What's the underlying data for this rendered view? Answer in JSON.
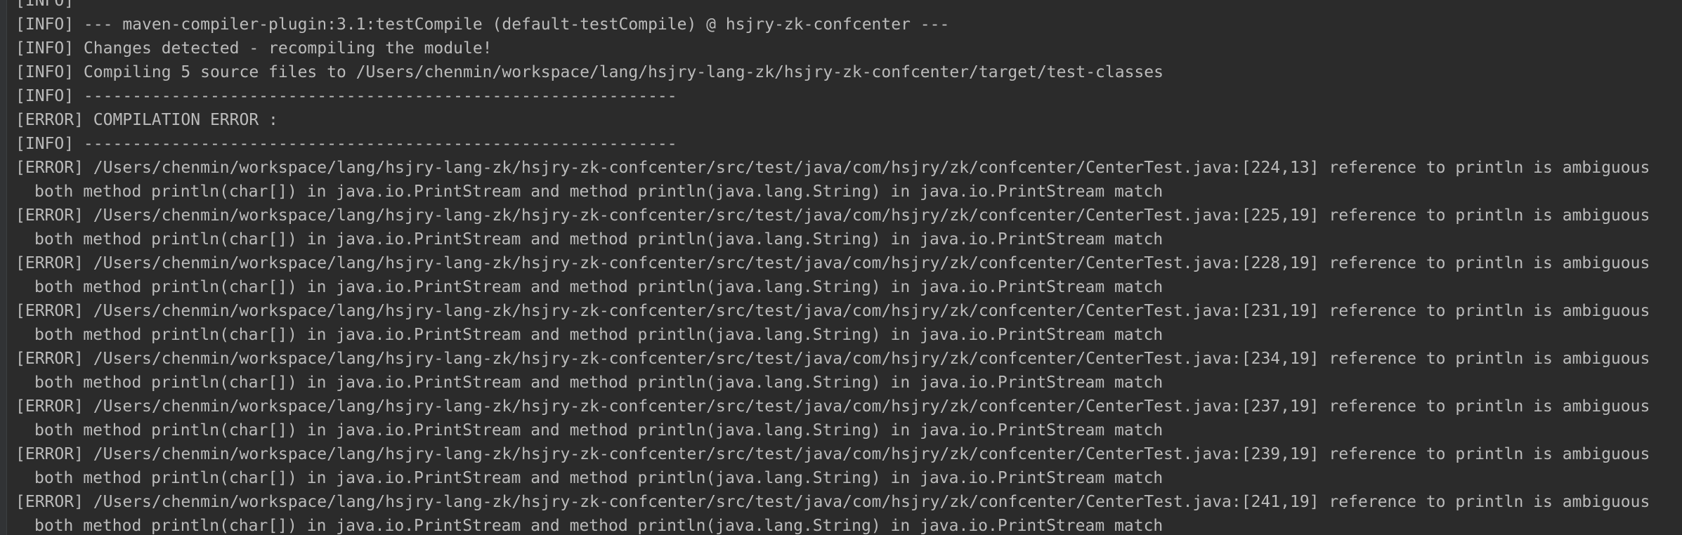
{
  "console": {
    "lines": [
      {
        "text": "[INFO]",
        "cont": false
      },
      {
        "text": "[INFO] --- maven-compiler-plugin:3.1:testCompile (default-testCompile) @ hsjry-zk-confcenter ---",
        "cont": false
      },
      {
        "text": "[INFO] Changes detected - recompiling the module!",
        "cont": false
      },
      {
        "text": "[INFO] Compiling 5 source files to /Users/chenmin/workspace/lang/hsjry-lang-zk/hsjry-zk-confcenter/target/test-classes",
        "cont": false
      },
      {
        "text": "[INFO] -------------------------------------------------------------",
        "cont": false
      },
      {
        "text": "[ERROR] COMPILATION ERROR :",
        "cont": false
      },
      {
        "text": "[INFO] -------------------------------------------------------------",
        "cont": false
      },
      {
        "text": "[ERROR] /Users/chenmin/workspace/lang/hsjry-lang-zk/hsjry-zk-confcenter/src/test/java/com/hsjry/zk/confcenter/CenterTest.java:[224,13] reference to println is ambiguous",
        "cont": false
      },
      {
        "text": "both method println(char[]) in java.io.PrintStream and method println(java.lang.String) in java.io.PrintStream match",
        "cont": true
      },
      {
        "text": "[ERROR] /Users/chenmin/workspace/lang/hsjry-lang-zk/hsjry-zk-confcenter/src/test/java/com/hsjry/zk/confcenter/CenterTest.java:[225,19] reference to println is ambiguous",
        "cont": false
      },
      {
        "text": "both method println(char[]) in java.io.PrintStream and method println(java.lang.String) in java.io.PrintStream match",
        "cont": true
      },
      {
        "text": "[ERROR] /Users/chenmin/workspace/lang/hsjry-lang-zk/hsjry-zk-confcenter/src/test/java/com/hsjry/zk/confcenter/CenterTest.java:[228,19] reference to println is ambiguous",
        "cont": false
      },
      {
        "text": "both method println(char[]) in java.io.PrintStream and method println(java.lang.String) in java.io.PrintStream match",
        "cont": true
      },
      {
        "text": "[ERROR] /Users/chenmin/workspace/lang/hsjry-lang-zk/hsjry-zk-confcenter/src/test/java/com/hsjry/zk/confcenter/CenterTest.java:[231,19] reference to println is ambiguous",
        "cont": false
      },
      {
        "text": "both method println(char[]) in java.io.PrintStream and method println(java.lang.String) in java.io.PrintStream match",
        "cont": true
      },
      {
        "text": "[ERROR] /Users/chenmin/workspace/lang/hsjry-lang-zk/hsjry-zk-confcenter/src/test/java/com/hsjry/zk/confcenter/CenterTest.java:[234,19] reference to println is ambiguous",
        "cont": false
      },
      {
        "text": "both method println(char[]) in java.io.PrintStream and method println(java.lang.String) in java.io.PrintStream match",
        "cont": true
      },
      {
        "text": "[ERROR] /Users/chenmin/workspace/lang/hsjry-lang-zk/hsjry-zk-confcenter/src/test/java/com/hsjry/zk/confcenter/CenterTest.java:[237,19] reference to println is ambiguous",
        "cont": false
      },
      {
        "text": "both method println(char[]) in java.io.PrintStream and method println(java.lang.String) in java.io.PrintStream match",
        "cont": true
      },
      {
        "text": "[ERROR] /Users/chenmin/workspace/lang/hsjry-lang-zk/hsjry-zk-confcenter/src/test/java/com/hsjry/zk/confcenter/CenterTest.java:[239,19] reference to println is ambiguous",
        "cont": false
      },
      {
        "text": "both method println(char[]) in java.io.PrintStream and method println(java.lang.String) in java.io.PrintStream match",
        "cont": true
      },
      {
        "text": "[ERROR] /Users/chenmin/workspace/lang/hsjry-lang-zk/hsjry-zk-confcenter/src/test/java/com/hsjry/zk/confcenter/CenterTest.java:[241,19] reference to println is ambiguous",
        "cont": false
      },
      {
        "text": "both method println(char[]) in java.io.PrintStream and method println(java.lang.String) in java.io.PrintStream match",
        "cont": true
      }
    ]
  },
  "colors": {
    "background": "#2b2b2b",
    "text": "#bbbbbb"
  }
}
